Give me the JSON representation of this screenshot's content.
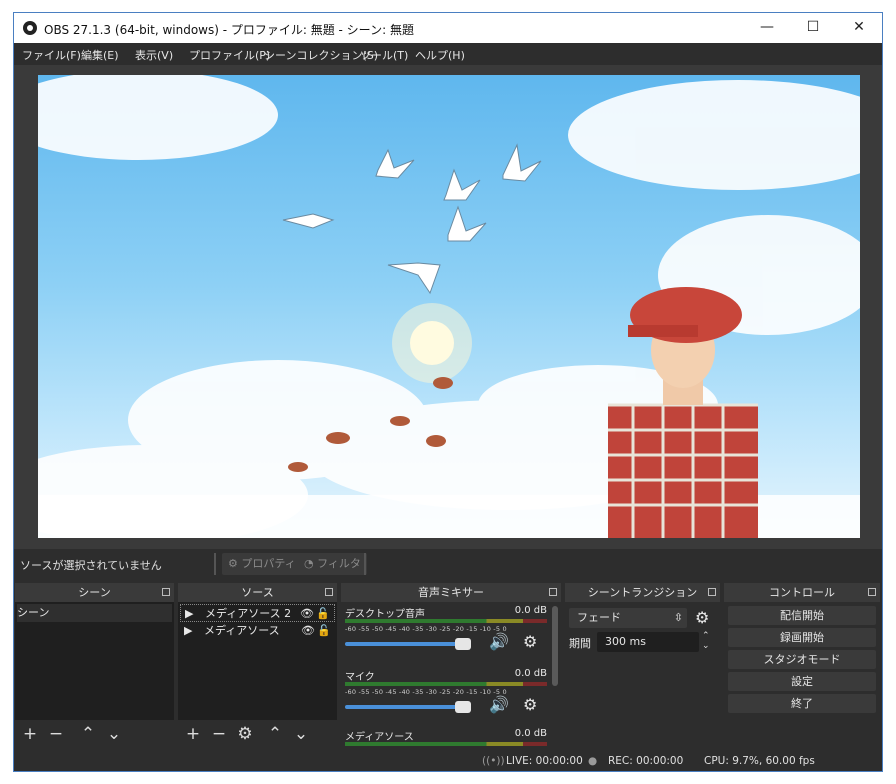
{
  "window": {
    "title": "OBS 27.1.3 (64-bit, windows) - プロファイル: 無題 - シーン: 無題",
    "min_label": "—",
    "max_label": "☐",
    "close_label": "✕"
  },
  "menu": [
    "ファイル(F)",
    "編集(E)",
    "表示(V)",
    "プロファイル(P)",
    "シーンコレクション(S)",
    "ツール(T)",
    "ヘルプ(H)"
  ],
  "toolbar": {
    "no_source": "ソースが選択されていません",
    "properties": "プロパティ",
    "filters": "フィルタ"
  },
  "scenes": {
    "title": "シーン",
    "items": [
      "シーン"
    ]
  },
  "sources": {
    "title": "ソース",
    "items": [
      "メディアソース 2",
      "メディアソース"
    ]
  },
  "mixer": {
    "title": "音声ミキサー",
    "ticks": "-60 -55 -50 -45 -40 -35 -30 -25 -20 -15 -10  -5   0",
    "channels": [
      {
        "name": "デスクトップ音声",
        "db": "0.0 dB"
      },
      {
        "name": "マイク",
        "db": "0.0 dB"
      },
      {
        "name": "メディアソース",
        "db": "0.0 dB"
      }
    ]
  },
  "transitions": {
    "title": "シーントランジション",
    "selected": "フェード",
    "duration_label": "期間",
    "duration_value": "300 ms"
  },
  "controls": {
    "title": "コントロール",
    "buttons": [
      "配信開始",
      "録画開始",
      "スタジオモード",
      "設定",
      "終了"
    ]
  },
  "status": {
    "live": "LIVE: 00:00:00",
    "rec": "REC: 00:00:00",
    "cpu": "CPU: 9.7%, 60.00 fps"
  },
  "colors": {
    "panel_bg": "#2d2d2d",
    "list_bg": "#1f1f1f",
    "accent_slider": "#4a90d9",
    "sky": "#8dd0f5"
  }
}
